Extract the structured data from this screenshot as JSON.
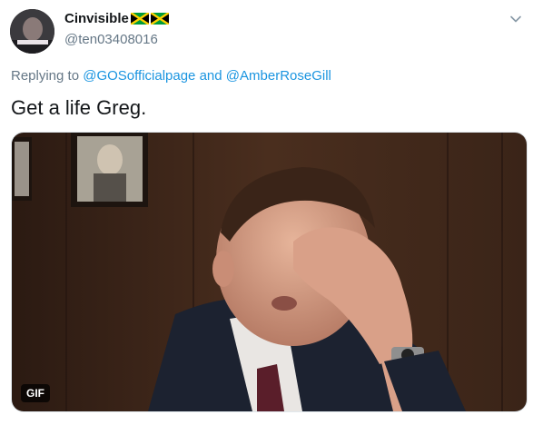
{
  "author": {
    "display_name": "Cinvisible",
    "handle": "@ten03408016",
    "flags": [
      "jamaica-flag",
      "jamaica-flag"
    ]
  },
  "reply": {
    "prefix": "Replying to",
    "mention1": "@GOSofficialpage",
    "conjunction": "and",
    "mention2": "@AmberRoseGill"
  },
  "tweet": {
    "text": "Get a life Greg."
  },
  "media": {
    "badge": "GIF"
  },
  "colors": {
    "link": "#1b95e0",
    "secondary_text": "#657786",
    "primary_text": "#14171a"
  }
}
